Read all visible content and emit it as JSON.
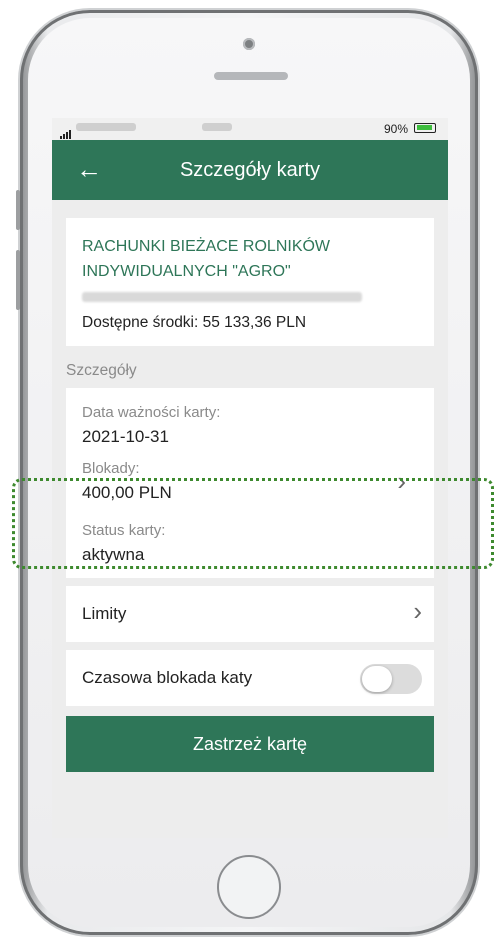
{
  "status_bar": {
    "battery": "90%"
  },
  "app_bar": {
    "back_icon": "arrow-left-icon",
    "title": "Szczegóły karty"
  },
  "account": {
    "name": "RACHUNKI BIEŻACE ROLNIKÓW INDYWIDUALNYCH \"AGRO\"",
    "available_funds": "Dostępne środki: 55 133,36 PLN"
  },
  "details": {
    "section_label": "Szczegóły",
    "expiry_label": "Data ważności karty:",
    "expiry_value": "2021-10-31",
    "blocks_label": "Blokady:",
    "blocks_value": "400,00 PLN",
    "status_label": "Status karty:",
    "status_value": "aktywna"
  },
  "limits": {
    "label": "Limity"
  },
  "temp_block": {
    "label": "Czasowa blokada katy",
    "enabled": false
  },
  "restrict_button": {
    "label": "Zastrzeż kartę"
  },
  "colors": {
    "brand": "#2e7658",
    "highlight": "#3e8a2f"
  }
}
